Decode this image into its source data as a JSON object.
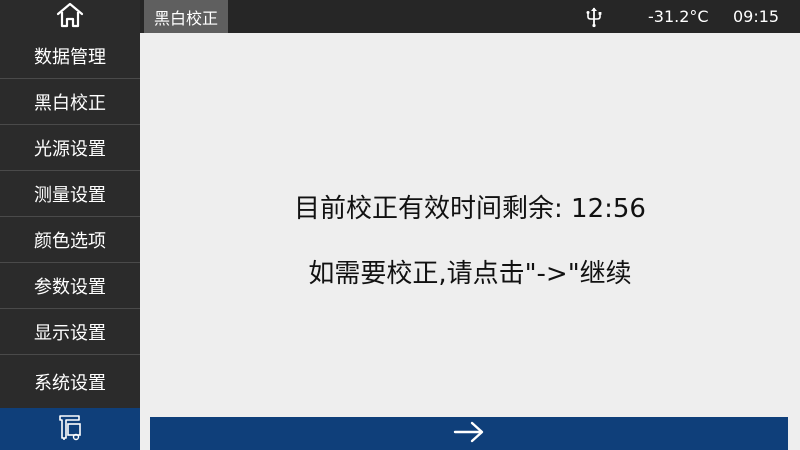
{
  "header": {
    "title": "黑白校正",
    "temperature": "-31.2°C",
    "time": "09:15"
  },
  "sidebar": {
    "items": [
      {
        "label": "数据管理"
      },
      {
        "label": "黑白校正"
      },
      {
        "label": "光源设置"
      },
      {
        "label": "测量设置"
      },
      {
        "label": "颜色选项"
      },
      {
        "label": "参数设置"
      },
      {
        "label": "显示设置"
      },
      {
        "label": "系统设置"
      }
    ]
  },
  "main": {
    "remaining_text": "目前校正有效时间剩余: 12:56",
    "instruction_text": "如需要校正,请点击\"->\"继续"
  },
  "icons": {
    "home": "home-icon",
    "usb": "usb-icon",
    "device": "device-icon",
    "continue": "arrow-right-icon"
  },
  "colors": {
    "sidebar_bg": "#2b2b2b",
    "topbar_bg": "#262626",
    "active_tab": "#5f5f5f",
    "accent": "#0f3f7a",
    "content_bg": "#eeeeee"
  }
}
